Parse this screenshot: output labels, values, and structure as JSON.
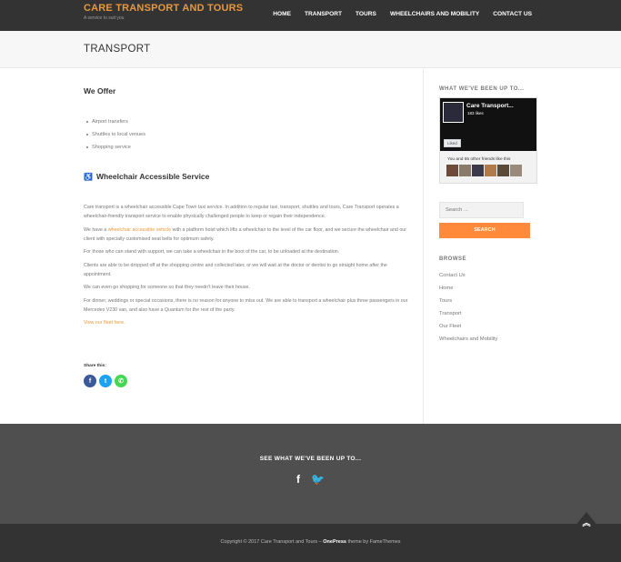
{
  "site": {
    "title": "CARE TRANSPORT AND TOURS",
    "tagline": "A service to suit you"
  },
  "nav": [
    "HOME",
    "TRANSPORT",
    "TOURS",
    "WHEELCHAIRS AND MOBILITY",
    "CONTACT US"
  ],
  "page_title": "TRANSPORT",
  "main": {
    "offer_heading": "We Offer",
    "offer_items": [
      "Airport transfers",
      "Shuttles to local venues",
      "Shopping service"
    ],
    "wheelchair_heading": "Wheelchair Accessible Service",
    "p1": "Care transport is a wheelchair accessible Cape Town taxi service. In addition to regular taxi, transport, shuttles and tours, Care Transport operates a wheelchair-friendly transport service to enable physically challenged people to keep or regain their independence.",
    "p2_before": "We have a ",
    "p2_link": "wheelchair accessible vehicle",
    "p2_after": " with a platform hoist which lifts a wheelchair to the level of the car floor, and we secure the wheelchair and our client with specially customised seat belts for optimum safety.",
    "p3": "For those who can stand with support, we can take a wheelchair in the boot of the car, to be unloaded at the destination.",
    "p4": "Clients are able to be dropped off at the shopping centre and collected later, or we will wait at the doctor or dentist to go straight home after the appointment.",
    "p5": "We can even go shopping for someone so that they needn't leave their house.",
    "p6": "For dinner, weddings or special occasions, there is no reason for anyone to miss out. We are able to transport a wheelchair plus three passengers in our Mercedes V230 van, and also have a Quantum for the rest of the party.",
    "fleet_link": "View our fleet here.",
    "share_label": "Share this:"
  },
  "sidebar": {
    "widget_heading": "WHAT WE'VE BEEN UP TO...",
    "fb_page_name": "Care Transport...",
    "fb_likes": "183 likes",
    "fb_like_button": "Liked",
    "fb_friends": "You and 55 other friends like this",
    "search_placeholder": "Search ...",
    "search_button": "SEARCH",
    "browse_heading": "BROWSE",
    "browse_items": [
      "Contact Us",
      "Home",
      "Tours",
      "Transport",
      "Our Fleet"
    ],
    "extra_link": "Wheelchairs and Mobility"
  },
  "footer": {
    "heading": "SEE WHAT WE'VE BEEN UP TO...",
    "copyright_pre": "Copyright © 2017 Care Transport and Tours – ",
    "theme_name": "OnePress",
    "copyright_post": " theme by FameThemes"
  },
  "colors": {
    "accent": "#e9973a",
    "search_button": "#ff8a3c",
    "header_bg": "#333333",
    "footer_bg": "#4f4f4f"
  },
  "icons": {
    "wheelchair": "wheelchair-icon",
    "share": [
      "facebook-icon",
      "twitter-icon",
      "whatsapp-icon"
    ],
    "footer_social": [
      "facebook-icon",
      "twitter-icon"
    ],
    "back_to_top": "chevron-double-up-icon"
  }
}
